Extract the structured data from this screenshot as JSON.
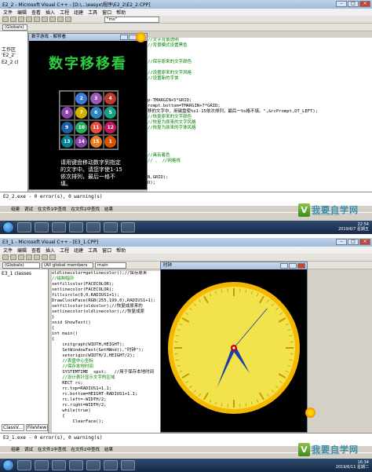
{
  "shot1": {
    "ide_title": "E2_2 - Microsoft Visual C++ - [D:\\...\\easyx\\程序\\E2_2\\E2_2.CPP]",
    "menu": [
      "文件",
      "编辑",
      "查看",
      "插入",
      "工程",
      "组建",
      "工具",
      "窗口",
      "帮助"
    ],
    "combo_globals": "(Globals)",
    "combo_text": "\"ms\"",
    "workspace_label": "工作区 'E2_2'",
    "project_label": "E2_2 cl",
    "code_lines": [
      {
        "t": "//文字背景透明",
        "c": "cm"
      },
      {
        "t": "//背景模式设置黑色",
        "c": "cm"
      },
      {
        "t": "",
        "c": ""
      },
      {
        "t": "",
        "c": ""
      },
      {
        "t": "//保存原来的文字颜色",
        "c": "cm"
      },
      {
        "t": "",
        "c": ""
      },
      {
        "t": "//设置原来的文字风格",
        "c": "cm"
      },
      {
        "t": "//设置新的字体",
        "c": "cm"
      },
      {
        "t": "",
        "c": ""
      },
      {
        "t": "",
        "c": ""
      },
      {
        "t": "",
        "c": ""
      },
      {
        "t": "p-TMARGIN+5*GRID;",
        "c": ""
      },
      {
        "t": "rompt.bottom=TMARGIN+7*GRID;",
        "c": ""
      },
      {
        "t": "移的文字中，用键盘使%s1-15依次排列，最后一%s格不填。\",&rcPrompt,DT_LEFT);",
        "c": ""
      },
      {
        "t": "//恢复原来的文字颜色",
        "c": "cm"
      },
      {
        "t": "//恢复为原来的文字风格",
        "c": "cm"
      },
      {
        "t": "//恢复为原来的字体风格",
        "c": "cm"
      },
      {
        "t": "",
        "c": ""
      },
      {
        "t": "",
        "c": ""
      },
      {
        "t": "",
        "c": ""
      },
      {
        "t": "",
        "c": ""
      },
      {
        "t": "//具有着色",
        "c": "cm"
      },
      {
        "t": "// 、 //网格线",
        "c": "cm"
      },
      {
        "t": "",
        "c": ""
      },
      {
        "t": "",
        "c": ""
      },
      {
        "t": "N,GRID);",
        "c": ""
      },
      {
        "t": "D);",
        "c": ""
      }
    ],
    "output_line": "E2_2.exe - 0 error(s), 0 warning(s)",
    "output_tabs": [
      "组建",
      "调试",
      "在文件1中查找",
      "在文件2中查找",
      "结果"
    ],
    "console_title": "数字游戏 - 解移看",
    "game_title": "数字移移看",
    "tiles": [
      {
        "n": "",
        "color": ""
      },
      {
        "n": "2",
        "color": "#3d7bd9"
      },
      {
        "n": "3",
        "color": "#9b59b6"
      },
      {
        "n": "4",
        "color": "#c0392b"
      },
      {
        "n": "8",
        "color": "#8e44ad"
      },
      {
        "n": "7",
        "color": "#d4b000"
      },
      {
        "n": "6",
        "color": "#2e86c1"
      },
      {
        "n": "5",
        "color": "#16a085"
      },
      {
        "n": "9",
        "color": "#1f5fa8"
      },
      {
        "n": "10",
        "color": "#27ae60"
      },
      {
        "n": "11",
        "color": "#e74c3c"
      },
      {
        "n": "12",
        "color": "#c2185b"
      },
      {
        "n": "13",
        "color": "#00838f"
      },
      {
        "n": "14",
        "color": "#8e44ad"
      },
      {
        "n": "15",
        "color": "#e67e22"
      },
      {
        "n": "1",
        "color": "#d35400"
      }
    ],
    "instructions": "请用键盘移动数字到指定的文字中。请您字使1-15依次排列，最后一格不填。",
    "clock_time": "22:54",
    "clock_date": "2019/6/7 星期五"
  },
  "shot2": {
    "ide_title": "E3_1 - Microsoft Visual C++ - [E3_1.CPP]",
    "menu": [
      "文件",
      "编辑",
      "查看",
      "插入",
      "工程",
      "组建",
      "工具",
      "窗口",
      "帮助"
    ],
    "combo_globals": "(Globals)",
    "combo_members": "(All global members",
    "combo_func": "main",
    "project_label": "E3_1 classes",
    "fileview_label": "FileView",
    "classview_label": "ClassV...",
    "code_lines": [
      {
        "t": "oldlinecolor=getlinecolor();//保存原来",
        "c": ""
      },
      {
        "t": "//绘制指针",
        "c": "cm"
      },
      {
        "t": "setfillcolor(FACECOLOR);",
        "c": ""
      },
      {
        "t": "setlinecolor(FACECOLOR);",
        "c": ""
      },
      {
        "t": "fillcircle(0,0,RADIUS1+1);",
        "c": ""
      },
      {
        "t": "DrawClockFace(RGB(255,199,0),RADIUS1+1);",
        "c": ""
      },
      {
        "t": "setfillcolor(oldcolor);//恢复成原来的",
        "c": ""
      },
      {
        "t": "setlinecolor(oldlinecolor);//恢复成原",
        "c": ""
      },
      {
        "t": "}",
        "c": ""
      },
      {
        "t": "void ShowText()",
        "c": ""
      },
      {
        "t": "{",
        "c": ""
      },
      {
        "t": "int main()",
        "c": ""
      },
      {
        "t": "{",
        "c": ""
      },
      {
        "t": "    initgraph(WIDTH,HEIGHT);",
        "c": ""
      },
      {
        "t": "    SetWindowText(GetHWnd(),\"时钟\");",
        "c": ""
      },
      {
        "t": "    setorigin(WIDTH/2,HEIGHT/2);",
        "c": ""
      },
      {
        "t": "    //表盘中心坐标",
        "c": "cm"
      },
      {
        "t": "    //保存本地时间",
        "c": "cm"
      },
      {
        "t": "    SYSTEMTIME  spst;   //用于保存本地时间",
        "c": ""
      },
      {
        "t": "    //设计表针显示文字的区域",
        "c": "cm"
      },
      {
        "t": "    RECT rc;",
        "c": ""
      },
      {
        "t": "    rc.top=RADIUS1+1.1;",
        "c": ""
      },
      {
        "t": "    rc.bottom=HEIGHT-RADIUS1+1.1;",
        "c": ""
      },
      {
        "t": "    rc.left=-WIDTH/2;",
        "c": ""
      },
      {
        "t": "    rc.right=WIDTH/2;",
        "c": ""
      },
      {
        "t": "    while(true)",
        "c": ""
      },
      {
        "t": "    {",
        "c": ""
      },
      {
        "t": "        ClearFace();",
        "c": ""
      }
    ],
    "output_line": "E3_1.exe - 0 error(s), 0 warning(s)",
    "output_tabs": [
      "组建",
      "调试",
      "在文件1中查找",
      "在文件2中查找",
      "结果"
    ],
    "clock_window_title": "时钟",
    "clock_time": "16:34",
    "clock_date": "2019/6/11 星期二"
  },
  "watermark": {
    "text": "我要自学网",
    "url": "www.51zxw.net",
    "logo": "V"
  },
  "colors": {
    "clock_face": "#f2e24b",
    "clock_rim": "#f5b800",
    "hand": "#1a3faa",
    "center": "#cc0000"
  }
}
